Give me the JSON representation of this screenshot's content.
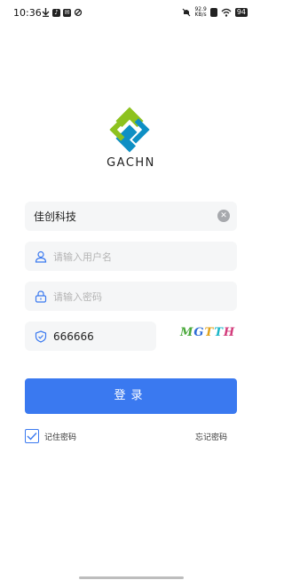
{
  "status_bar": {
    "time": "10:36",
    "network_speed_value": "92.9",
    "network_speed_unit": "KB/s",
    "battery": "94"
  },
  "brand": {
    "name": "GACHN"
  },
  "form": {
    "company_value": "佳创科技",
    "username_placeholder": "请输入用户名",
    "password_placeholder": "请输入密码",
    "captcha_value": "666666",
    "captcha_image_chars": [
      "M",
      "G",
      "T",
      "T",
      "H"
    ],
    "captcha_colors": [
      "#4aa83a",
      "#2d6bd6",
      "#e0a21b",
      "#18b6c8",
      "#d23a7a"
    ]
  },
  "actions": {
    "login_label": "登录",
    "remember_label": "记住密码",
    "remember_checked": true,
    "forgot_label": "忘记密码"
  },
  "colors": {
    "primary": "#3a79f0",
    "logo_green": "#8dc21f",
    "logo_blue": "#0e8fc4",
    "field_bg": "#f5f6f7"
  }
}
